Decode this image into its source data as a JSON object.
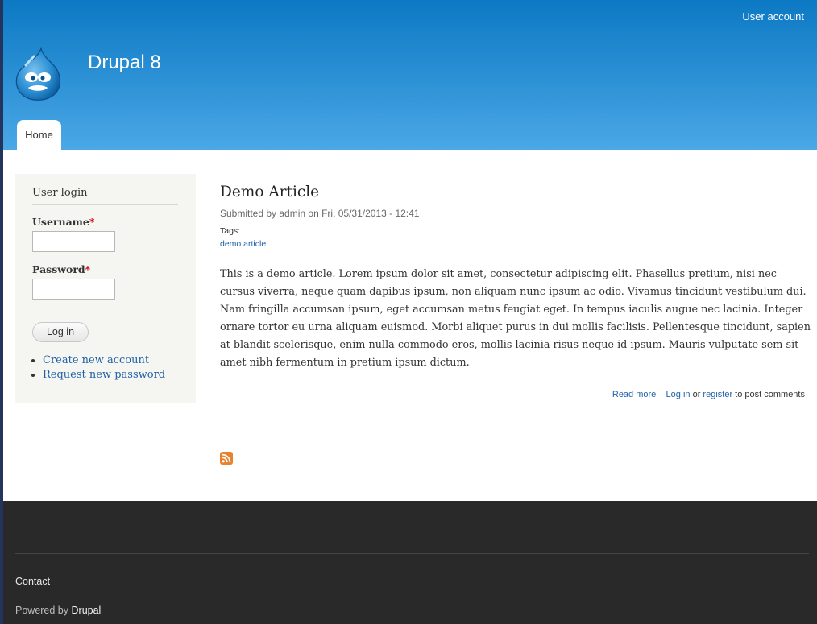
{
  "header": {
    "user_account": "User account",
    "site_name": "Drupal 8",
    "logo_icon": "drupal-drop-logo-icon",
    "tabs": [
      {
        "label": "Home",
        "active": true
      }
    ]
  },
  "sidebar": {
    "login": {
      "title": "User login",
      "username_label": "Username",
      "username_value": "",
      "password_label": "Password",
      "password_value": "",
      "required_marker": "*",
      "submit_label": "Log in",
      "links": [
        "Create new account",
        "Request new password"
      ]
    }
  },
  "article": {
    "title": "Demo Article",
    "submitted": "Submitted by admin on Fri, 05/31/2013 - 12:41",
    "tags_label": "Tags:",
    "tag": "demo article",
    "body": "This is a demo article. Lorem ipsum dolor sit amet, consectetur adipiscing elit. Phasellus pretium, nisi nec cursus viverra, neque quam dapibus ipsum, non aliquam nunc ipsum ac odio. Vivamus tincidunt vestibulum dui. Nam fringilla accumsan ipsum, eget accumsan metus feugiat eget. In tempus iaculis augue nec lacinia. Integer ornare tortor eu urna aliquam euismod. Morbi aliquet purus in dui mollis facilisis. Pellentesque tincidunt, sapien at blandit scelerisque, enim nulla commodo eros, mollis lacinia risus neque id ipsum. Mauris vulputate sem sit amet nibh fermentum in pretium ipsum dictum.",
    "links": {
      "read_more": "Read more",
      "log_in": "Log in",
      "or": "or",
      "register": "register",
      "suffix": "to post comments"
    },
    "feed_icon": "rss-feed-icon"
  },
  "footer": {
    "contact": "Contact",
    "powered_by": "Powered by",
    "powered_link": "Drupal"
  },
  "colors": {
    "header_top": "#0c79c4",
    "header_bottom": "#4aa8e6",
    "link": "#1f62a6",
    "footer_bg": "#292929",
    "required": "#cc0000"
  }
}
